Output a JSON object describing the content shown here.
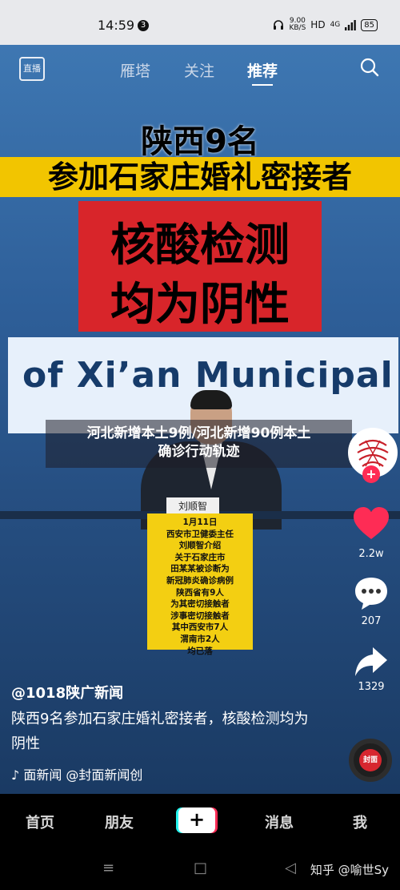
{
  "status_bar": {
    "time": "14:59",
    "notification_count": "3",
    "net_speed_value": "9.00",
    "net_speed_unit": "KB/S",
    "hd": "HD",
    "network": "4G",
    "battery": "85"
  },
  "top_nav": {
    "live_label": "直播",
    "tabs": [
      {
        "label": "雁塔",
        "active": false
      },
      {
        "label": "关注",
        "active": false
      },
      {
        "label": "推荐",
        "active": true
      }
    ]
  },
  "video": {
    "headline_line1": "陕西9名",
    "headline_line2": "参加石家庄婚礼密接者",
    "red_line1": "核酸检测",
    "red_line2": "均为阴性",
    "banner_text": "of Xi’an Municipal P",
    "nameplate": "刘顺智",
    "notice_lines": [
      "1月11日",
      "西安市卫健委主任",
      "刘顺智介绍",
      "关于石家庄市",
      "田某某被诊断为",
      "新冠肺炎确诊病例",
      "陕西省有9人",
      "为其密切接触者",
      "涉事密切接触者",
      "其中西安市7人",
      "渭南市2人",
      "均已落"
    ],
    "caption_line1": "河北新增本土9例/河北新增90例本土",
    "caption_line2": "确诊行动轨迹"
  },
  "right_rail": {
    "likes": "2.2w",
    "comments": "207",
    "shares": "1329",
    "music_disc_label": "封面"
  },
  "post": {
    "author": "@1018陕广新闻",
    "description": "陕西9名参加石家庄婚礼密接者，核酸检测均为阴性",
    "music_note": "♪",
    "music_text": "面新闻    @封面新闻创"
  },
  "bottom_nav": {
    "home": "首页",
    "friends": "朋友",
    "plus": "+",
    "messages": "消息",
    "me": "我"
  },
  "system_nav": {
    "menu": "≡",
    "home": "□",
    "back": "◁",
    "watermark": "知乎 @喻世Sy"
  },
  "colors": {
    "accent_red": "#fe2c55",
    "accent_cyan": "#25f4ee",
    "headline_yellow": "#f2c500",
    "red_box": "#d8252a"
  }
}
